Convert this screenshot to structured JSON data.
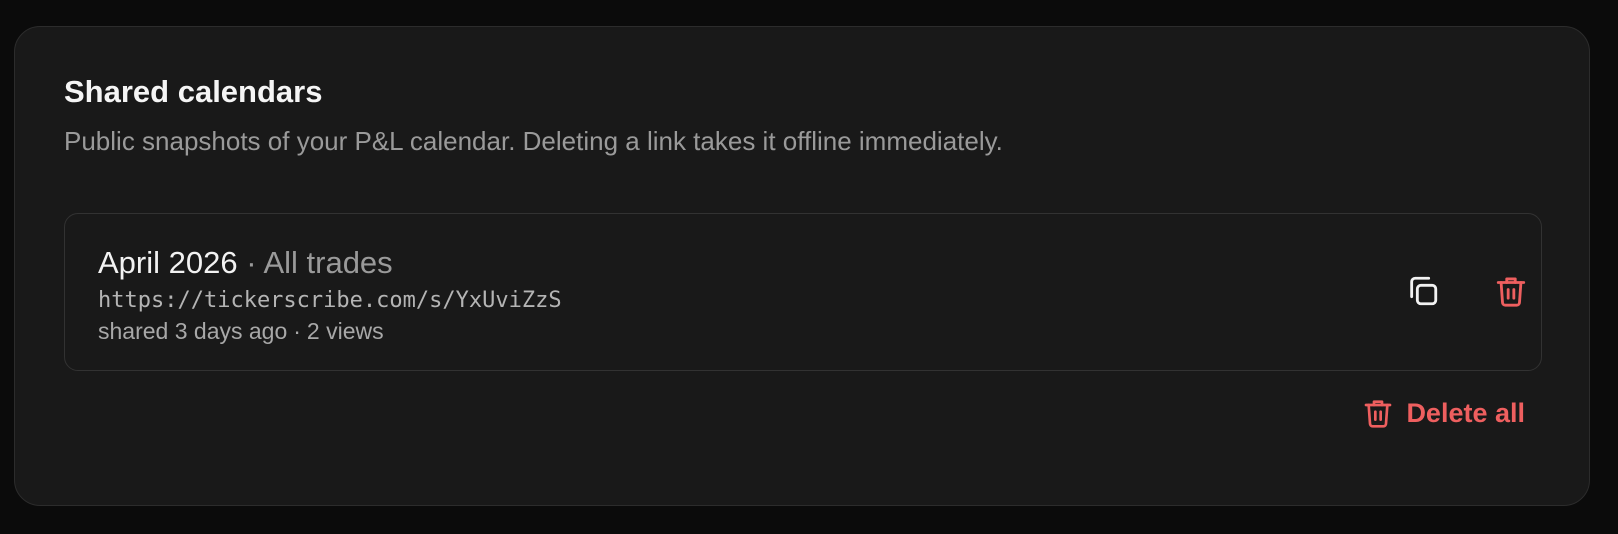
{
  "card": {
    "title": "Shared calendars",
    "description": "Public snapshots of your P&L calendar. Deleting a link takes it offline immediately."
  },
  "shares": [
    {
      "month": "April 2026",
      "separator": "·",
      "filter": "All trades",
      "url": "https://tickerscribe.com/s/YxUviZzS",
      "shared": "shared 3 days ago",
      "meta_separator": "·",
      "views": "2 views",
      "copy_icon": "copy-icon",
      "delete_icon": "trash-icon"
    }
  ],
  "actions": {
    "delete_all_label": "Delete all",
    "delete_all_icon": "trash-icon"
  },
  "colors": {
    "background": "#0b0b0b",
    "card": "#191919",
    "danger": "#ee5f5f",
    "text_primary": "#f5f5f5",
    "text_muted": "#9a9a9a"
  }
}
